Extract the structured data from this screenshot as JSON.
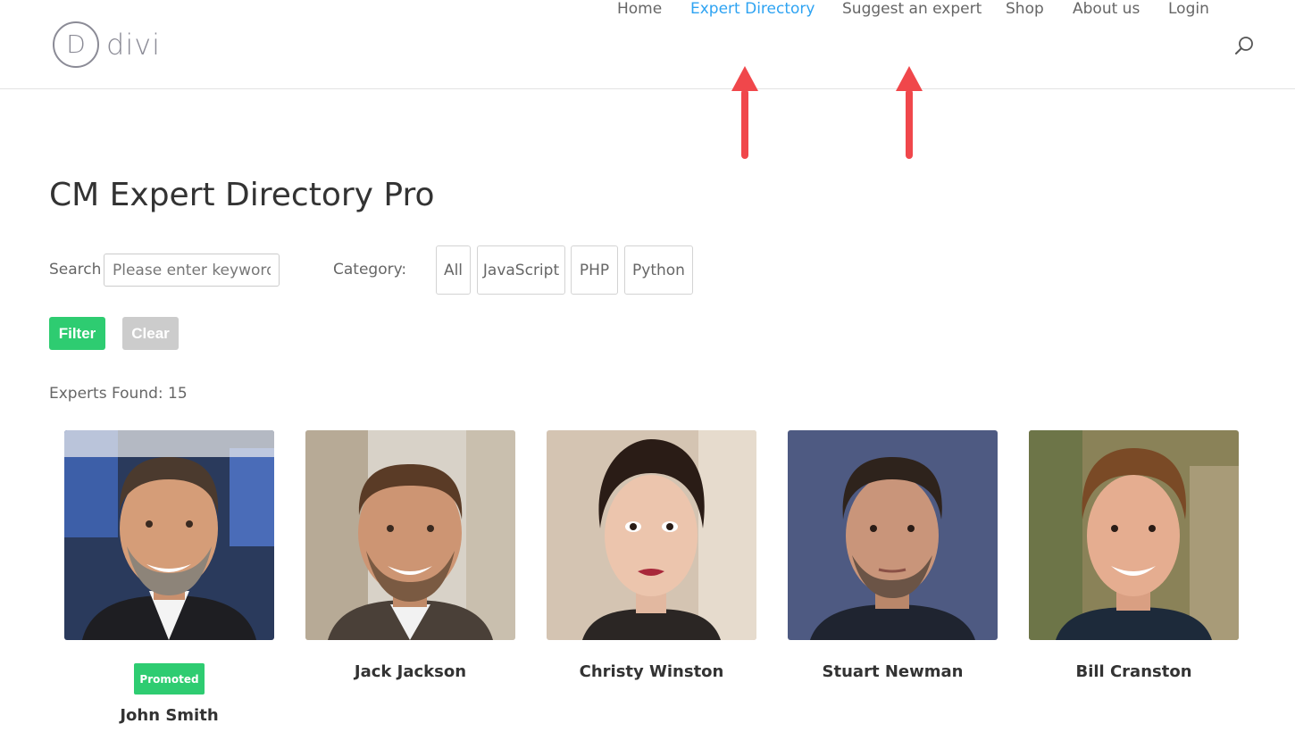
{
  "brand": {
    "logo_letter": "D",
    "logo_text": "divi"
  },
  "nav": {
    "items": [
      {
        "label": "Home",
        "active": false
      },
      {
        "label": "Expert Directory",
        "active": true
      },
      {
        "label": "Suggest an expert",
        "active": false
      },
      {
        "label": "Shop",
        "active": false
      },
      {
        "label": "About us",
        "active": false
      },
      {
        "label": "Login",
        "active": false
      }
    ],
    "search_icon": "search-icon"
  },
  "page": {
    "title": "CM Expert Directory Pro"
  },
  "filters": {
    "search_label": "Search",
    "search_placeholder": "Please enter keyword",
    "category_label": "Category:",
    "categories": [
      "All",
      "JavaScript",
      "PHP",
      "Python"
    ],
    "filter_label": "Filter",
    "clear_label": "Clear"
  },
  "results": {
    "experts_found": "Experts Found: 15"
  },
  "experts": [
    {
      "name": "John Smith",
      "badge": "Promoted"
    },
    {
      "name": "Jack Jackson"
    },
    {
      "name": "Christy Winston"
    },
    {
      "name": "Stuart Newman"
    },
    {
      "name": "Bill Cranston"
    }
  ],
  "colors": {
    "accent": "#2ea3f2",
    "green": "#2ecc71",
    "annotation_red": "#f0474b"
  }
}
